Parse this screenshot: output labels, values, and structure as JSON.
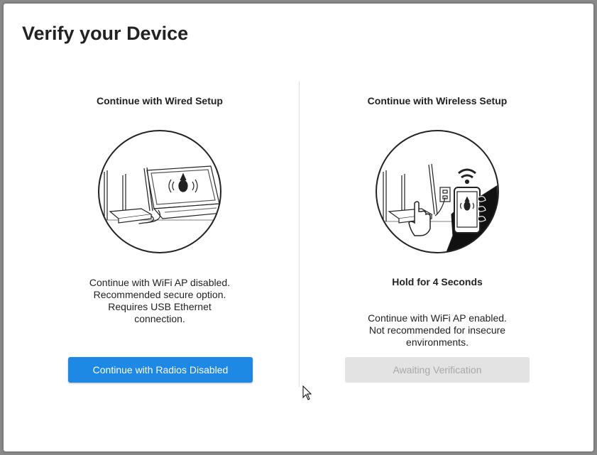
{
  "dialog": {
    "title": "Verify your Device"
  },
  "wired": {
    "heading": "Continue with Wired Setup",
    "description": [
      "Continue with WiFi AP disabled.",
      "Recommended secure option.",
      "Requires USB Ethernet",
      "connection."
    ],
    "button_label": "Continue with Radios Disabled"
  },
  "wireless": {
    "heading": "Continue with Wireless Setup",
    "hold_label": "Hold for 4 Seconds",
    "description": [
      "Continue with WiFi AP enabled.",
      "Not recommended for insecure",
      "environments."
    ],
    "button_label": "Awaiting Verification"
  },
  "colors": {
    "primary": "#1e88e5",
    "disabled_bg": "#e3e3e3",
    "disabled_text": "#a8a8a8"
  },
  "icons": [
    "laptop-router-illustration",
    "phone-wifi-illustration",
    "mouse-cursor-icon"
  ]
}
